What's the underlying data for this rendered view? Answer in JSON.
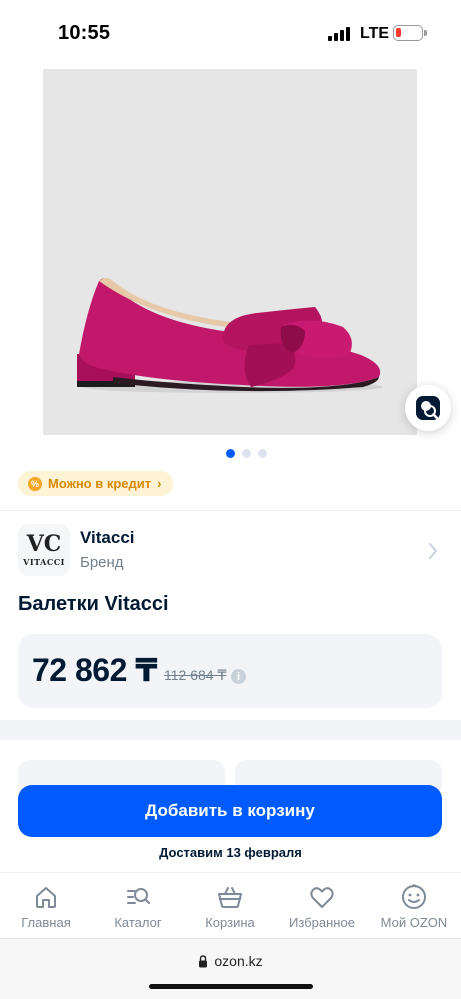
{
  "status_bar": {
    "time": "10:55",
    "network": "LTE"
  },
  "gallery": {
    "slides": 3,
    "active_slide": 1
  },
  "credit_badge": {
    "label": "Можно в кредит"
  },
  "brand": {
    "name": "Vitacci",
    "subtitle": "Бренд",
    "logo_text": "VITACCI",
    "logo_mark": "VC"
  },
  "product": {
    "title": "Балетки Vitacci"
  },
  "price": {
    "current": "72 862 ₸",
    "old": "112 684 ₸",
    "info": "i"
  },
  "cart": {
    "button_label": "Добавить в корзину",
    "delivery": "Доставим 13 февраля"
  },
  "tabs": [
    {
      "label": "Главная",
      "icon": "home-icon"
    },
    {
      "label": "Каталог",
      "icon": "catalog-icon"
    },
    {
      "label": "Корзина",
      "icon": "cart-icon"
    },
    {
      "label": "Избранное",
      "icon": "heart-icon"
    },
    {
      "label": "Мой OZON",
      "icon": "profile-icon"
    }
  ],
  "browser": {
    "url": "ozon.kz"
  },
  "colors": {
    "accent": "#005bff",
    "credit_bg": "#fff3d6",
    "credit_text": "#d98900",
    "shoe": "#c2186b"
  }
}
